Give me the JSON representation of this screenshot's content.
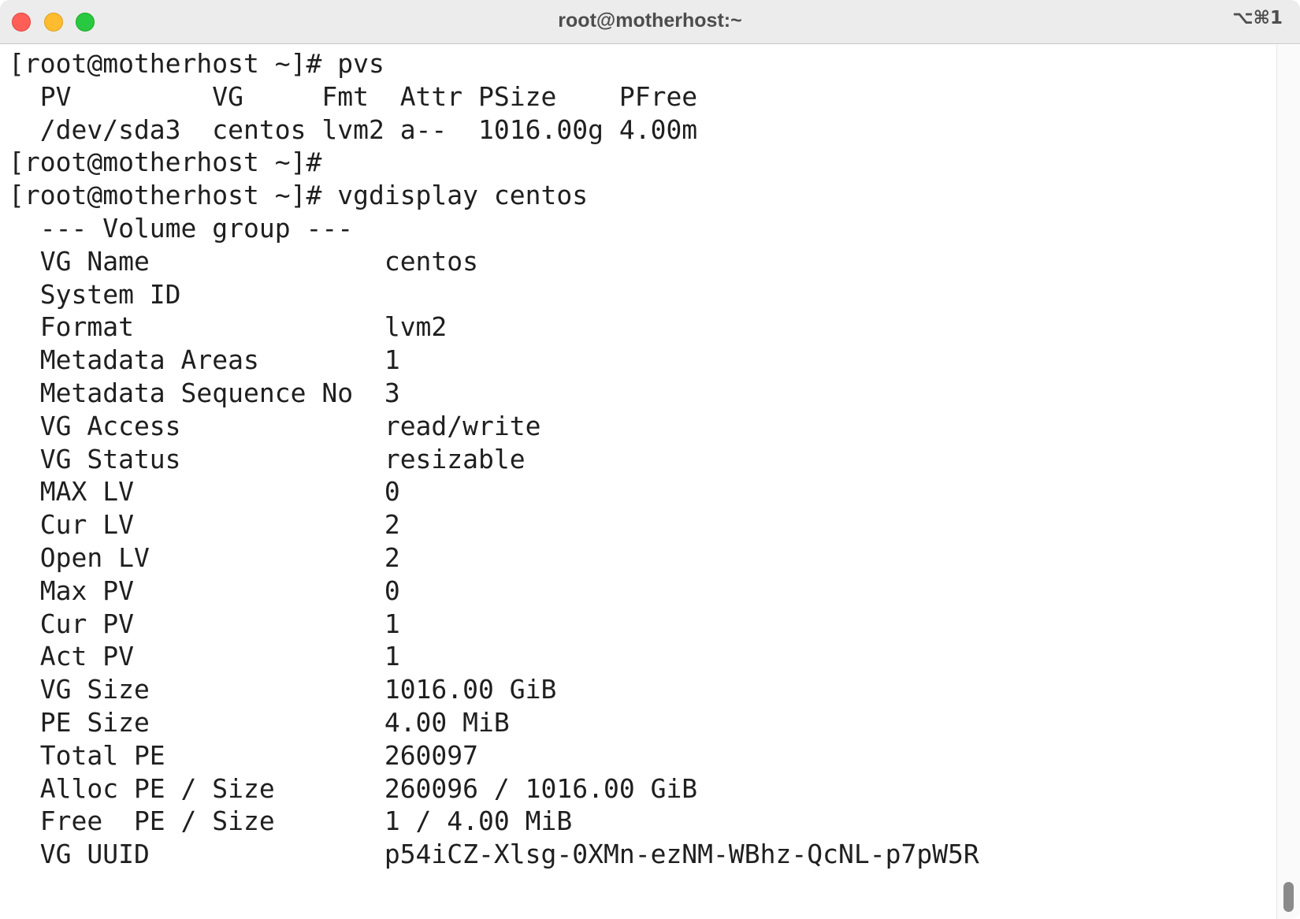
{
  "window": {
    "title": "root@motherhost:~",
    "shortcut": "⌥⌘1"
  },
  "terminal": {
    "lines": [
      "[root@motherhost ~]# pvs",
      "  PV         VG     Fmt  Attr PSize    PFree",
      "  /dev/sda3  centos lvm2 a--  1016.00g 4.00m",
      "[root@motherhost ~]#",
      "[root@motherhost ~]# vgdisplay centos",
      "  --- Volume group ---",
      "  VG Name               centos",
      "  System ID",
      "  Format                lvm2",
      "  Metadata Areas        1",
      "  Metadata Sequence No  3",
      "  VG Access             read/write",
      "  VG Status             resizable",
      "  MAX LV                0",
      "  Cur LV                2",
      "  Open LV               2",
      "  Max PV                0",
      "  Cur PV                1",
      "  Act PV                1",
      "  VG Size               1016.00 GiB",
      "  PE Size               4.00 MiB",
      "  Total PE              260097",
      "  Alloc PE / Size       260096 / 1016.00 GiB",
      "  Free  PE / Size       1 / 4.00 MiB",
      "  VG UUID               p54iCZ-Xlsg-0XMn-ezNM-WBhz-QcNL-p7pW5R"
    ]
  },
  "colors": {
    "close": "#ff5f57",
    "minimize": "#febc2e",
    "maximize": "#28c840",
    "text": "#1f1f1f",
    "titlebar": "#ececec"
  }
}
